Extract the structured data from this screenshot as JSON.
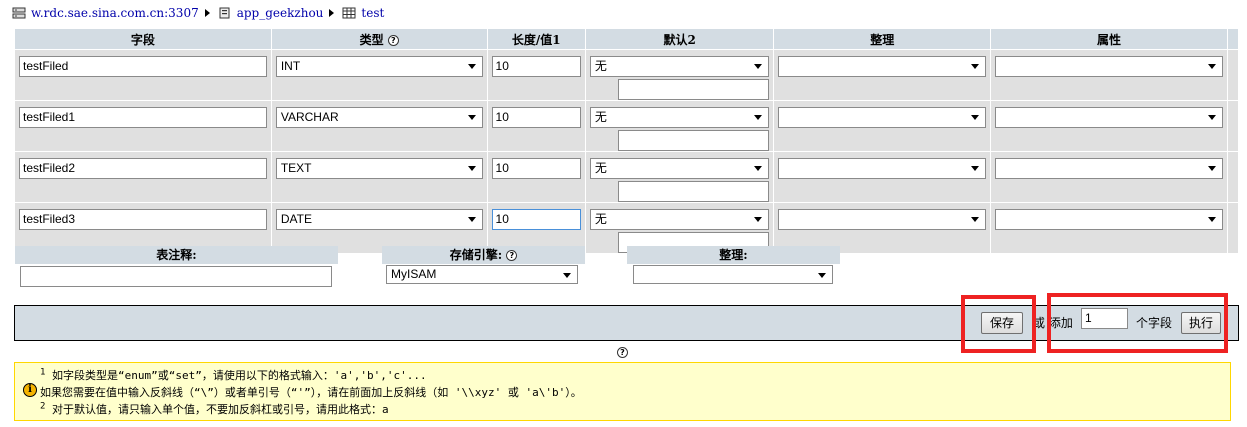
{
  "breadcrumb": {
    "server": "w.rdc.sae.sina.com.cn:3307",
    "database": "app_geekzhou",
    "table": "test"
  },
  "columns": [
    "字段",
    "类型",
    "长度/值1",
    "默认2",
    "整理",
    "属性"
  ],
  "rows": [
    {
      "field": "testFiled",
      "type": "INT",
      "length": "10",
      "default": "无",
      "collation": "",
      "attributes": ""
    },
    {
      "field": "testFiled1",
      "type": "VARCHAR",
      "length": "10",
      "default": "无",
      "collation": "",
      "attributes": ""
    },
    {
      "field": "testFiled2",
      "type": "TEXT",
      "length": "10",
      "default": "无",
      "collation": "",
      "attributes": ""
    },
    {
      "field": "testFiled3",
      "type": "DATE",
      "length": "10",
      "default": "无",
      "collation": "",
      "attributes": ""
    }
  ],
  "table_options": {
    "comment_label": "表注释:",
    "comment_value": "",
    "engine_label": "存储引擎:",
    "engine_value": "MyISAM",
    "collation_label": "整理:",
    "collation_value": ""
  },
  "actions": {
    "save_label": "保存",
    "or_add_label": "或 添加",
    "add_count": "1",
    "fields_label": "个字段",
    "execute_label": "执行"
  },
  "notice": {
    "line1_mark": "1",
    "line1": "如字段类型是“enum”或“set”，请使用以下的格式输入：'a','b','c'...",
    "line2": "如果您需要在值中输入反斜线（“\\”）或者单引号（“'”），请在前面加上反斜线（如 '\\\\xyz' 或 'a\\'b'）。",
    "line3_mark": "2",
    "line3": "对于默认值，请只输入单个值，不要加反斜杠或引号，请用此格式：a"
  },
  "icons": {
    "server": "server-icon",
    "database": "database-icon",
    "table": "table-icon",
    "help": "help-icon",
    "info": "info-icon"
  },
  "colors": {
    "header_bg": "#d3dce3",
    "row_bg": "#e0e0e0",
    "highlight": "#ee2222",
    "notice_bg": "#ffffcc"
  }
}
